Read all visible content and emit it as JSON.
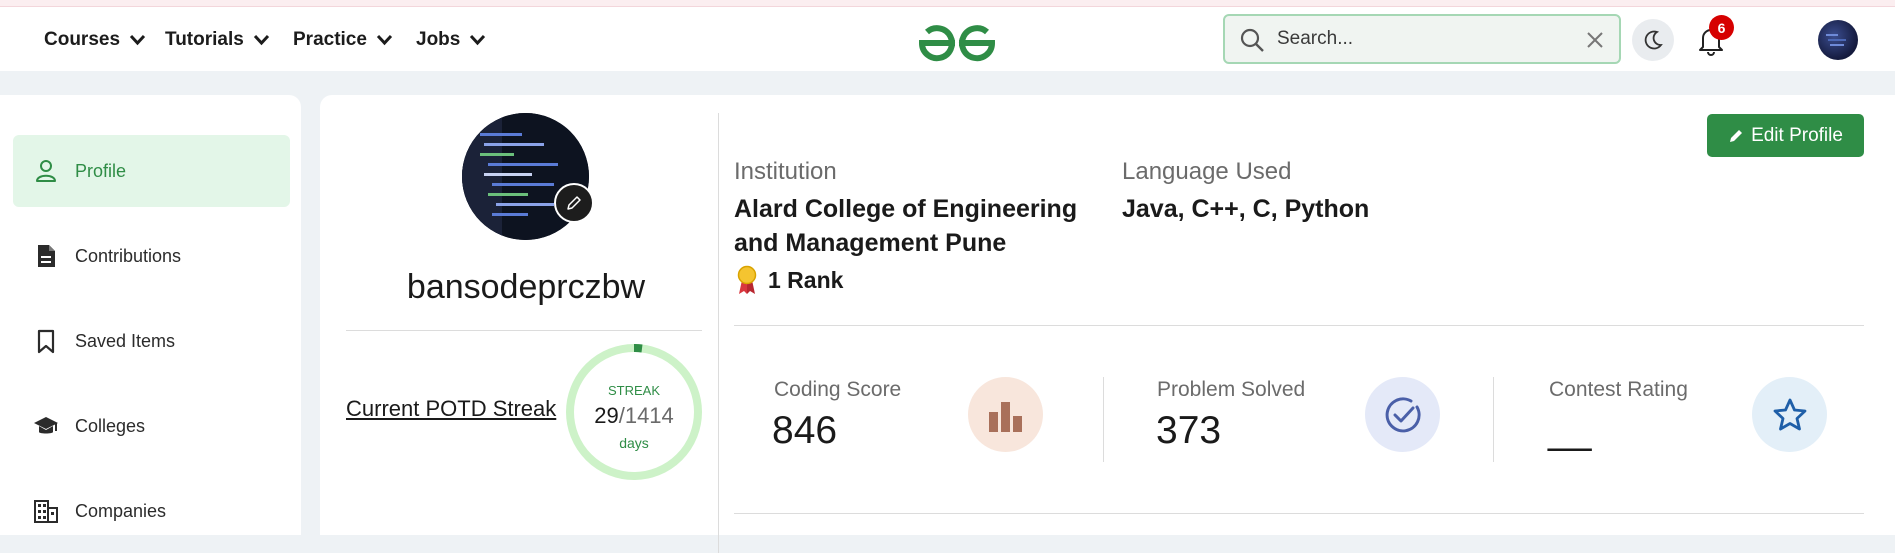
{
  "header": {
    "nav": [
      {
        "label": "Courses"
      },
      {
        "label": "Tutorials"
      },
      {
        "label": "Practice"
      },
      {
        "label": "Jobs"
      }
    ],
    "search_placeholder": "Search...",
    "notification_count": "6",
    "icons": [
      "chevron-down-icon",
      "gfg-logo",
      "search-icon",
      "close-icon",
      "moon-icon",
      "bell-icon",
      "avatar"
    ]
  },
  "sidebar": {
    "items": [
      {
        "label": "Profile",
        "icon": "user-icon",
        "active": true
      },
      {
        "label": "Contributions",
        "icon": "document-icon"
      },
      {
        "label": "Saved Items",
        "icon": "bookmark-icon"
      },
      {
        "label": "Colleges",
        "icon": "graduation-cap-icon"
      },
      {
        "label": "Companies",
        "icon": "building-icon"
      }
    ]
  },
  "profile": {
    "username": "bansodeprczbw",
    "potd_streak_label": "Current POTD Streak",
    "streak": {
      "title": "STREAK",
      "current": "29",
      "separator": "/",
      "total": "1414",
      "unit": "days"
    },
    "institution_label": "Institution",
    "institution_value": "Alard College of Engineering and Management Pune",
    "language_label": "Language Used",
    "language_value": "Java, C++, C, Python",
    "rank": "1 Rank",
    "edit_profile_label": "Edit Profile"
  },
  "stats": [
    {
      "label": "Coding Score",
      "value": "846",
      "icon": "bar-chart-icon"
    },
    {
      "label": "Problem Solved",
      "value": "373",
      "icon": "check-circle-icon"
    },
    {
      "label": "Contest Rating",
      "value": "__",
      "icon": "star-icon"
    }
  ],
  "colors": {
    "brand_green": "#2f8d46",
    "active_bg": "#e3f6e8",
    "badge_red": "#d60000"
  }
}
